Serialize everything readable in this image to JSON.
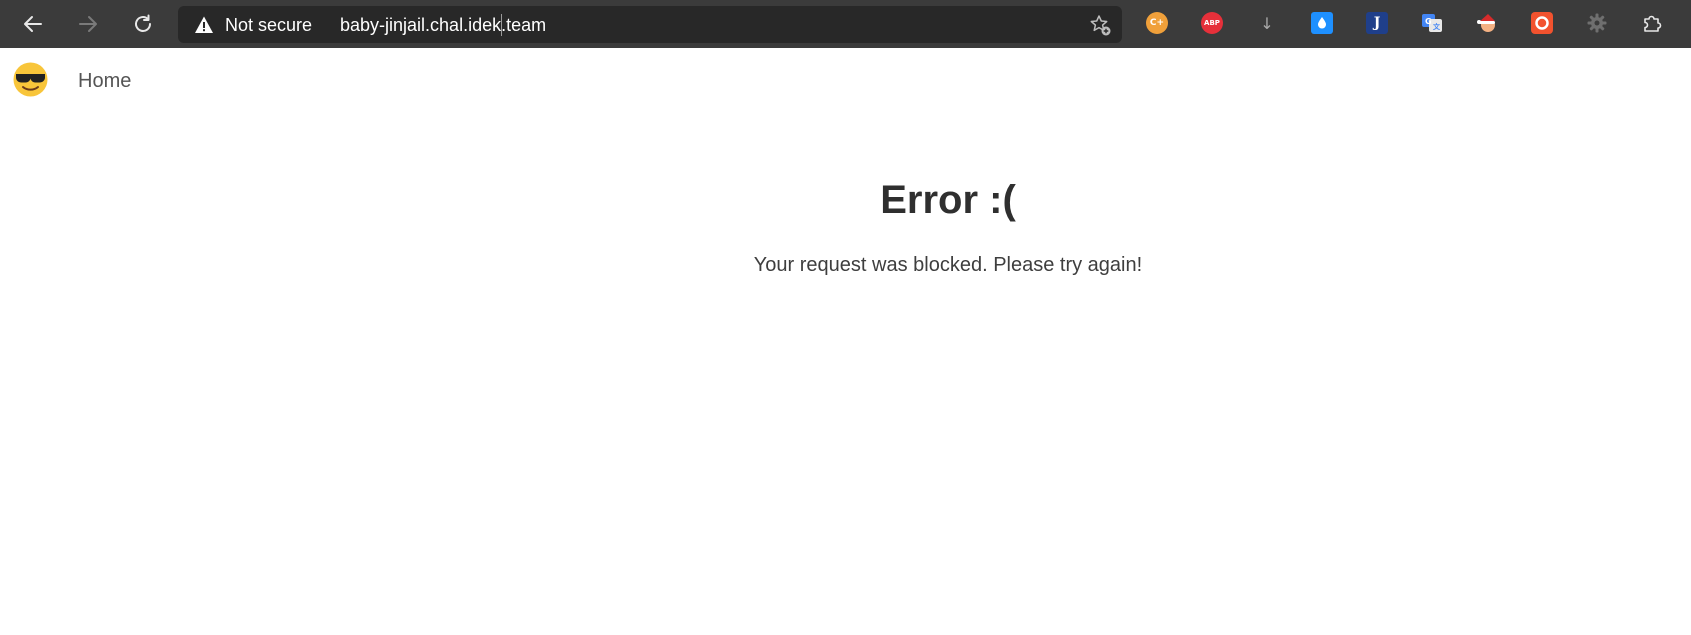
{
  "browser": {
    "security_label": "Not secure",
    "url": "baby-jinjail.chal.idek.team",
    "icons": {
      "back": "back-arrow-icon",
      "forward": "forward-arrow-icon",
      "reload": "reload-icon",
      "security": "warning-triangle-icon",
      "favorites": "add-favorite-icon"
    },
    "extensions": {
      "cplus_label": "C+",
      "abp_label": "ABP",
      "download_glyph": "↓",
      "drop_glyph": "💧",
      "j_label": "J"
    }
  },
  "page": {
    "nav": {
      "brand_icon": "sunglasses-emoji-icon",
      "home_label": "Home"
    },
    "error": {
      "title": "Error :(",
      "message": "Your request was blocked. Please try again!"
    }
  }
}
